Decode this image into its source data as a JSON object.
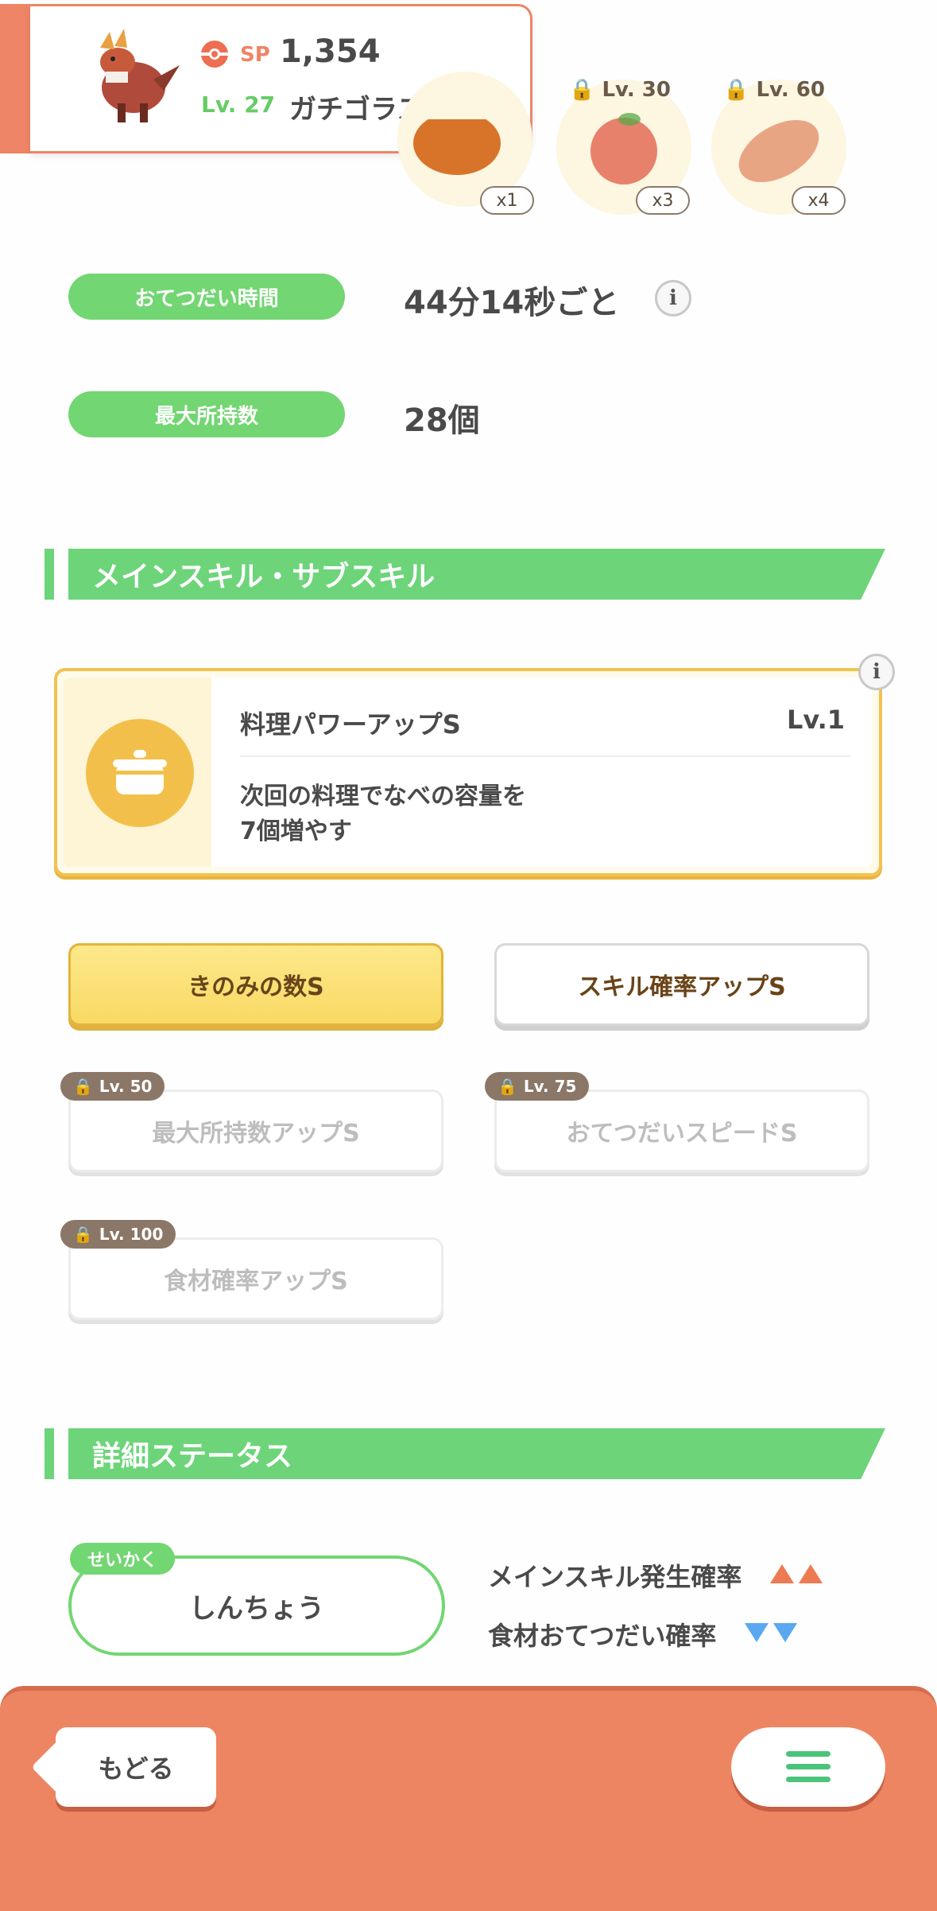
{
  "header": {
    "sp_label": "SP",
    "sp_value": "1,354",
    "level": "Lv. 27",
    "pokemon_name": "ガチゴラス"
  },
  "ingredients": [
    {
      "count": "x1",
      "lock": ""
    },
    {
      "count": "x3",
      "lock": "Lv. 30"
    },
    {
      "count": "x4",
      "lock": "Lv. 60"
    }
  ],
  "help_time": {
    "label": "おてつだい時間",
    "value": "44分14秒ごと"
  },
  "max_carry": {
    "label": "最大所持数",
    "value": "28個"
  },
  "skills_section": {
    "title": "メインスキル・サブスキル"
  },
  "main_skill": {
    "name": "料理パワーアップS",
    "level": "Lv.1",
    "desc_line1": "次回の料理でなべの容量を",
    "desc_line2": "7個増やす"
  },
  "sub_skills": [
    {
      "label": "きのみの数S",
      "lock": "",
      "state": "active-gold"
    },
    {
      "label": "スキル確率アップS",
      "lock": "",
      "state": "active"
    },
    {
      "label": "最大所持数アップS",
      "lock": "Lv. 50",
      "state": "locked"
    },
    {
      "label": "おてつだいスピードS",
      "lock": "Lv. 75",
      "state": "locked"
    },
    {
      "label": "食材確率アップS",
      "lock": "Lv. 100",
      "state": "locked"
    }
  ],
  "details_section": {
    "title": "詳細ステータス"
  },
  "nature": {
    "tag": "せいかく",
    "value": "しんちょう",
    "up_label": "メインスキル発生確率",
    "down_label": "食材おてつだい確率"
  },
  "nav": {
    "back_label": "もどる"
  },
  "colors": {
    "accent": "#ee8566",
    "green": "#72d672",
    "gold": "#f2c250"
  }
}
